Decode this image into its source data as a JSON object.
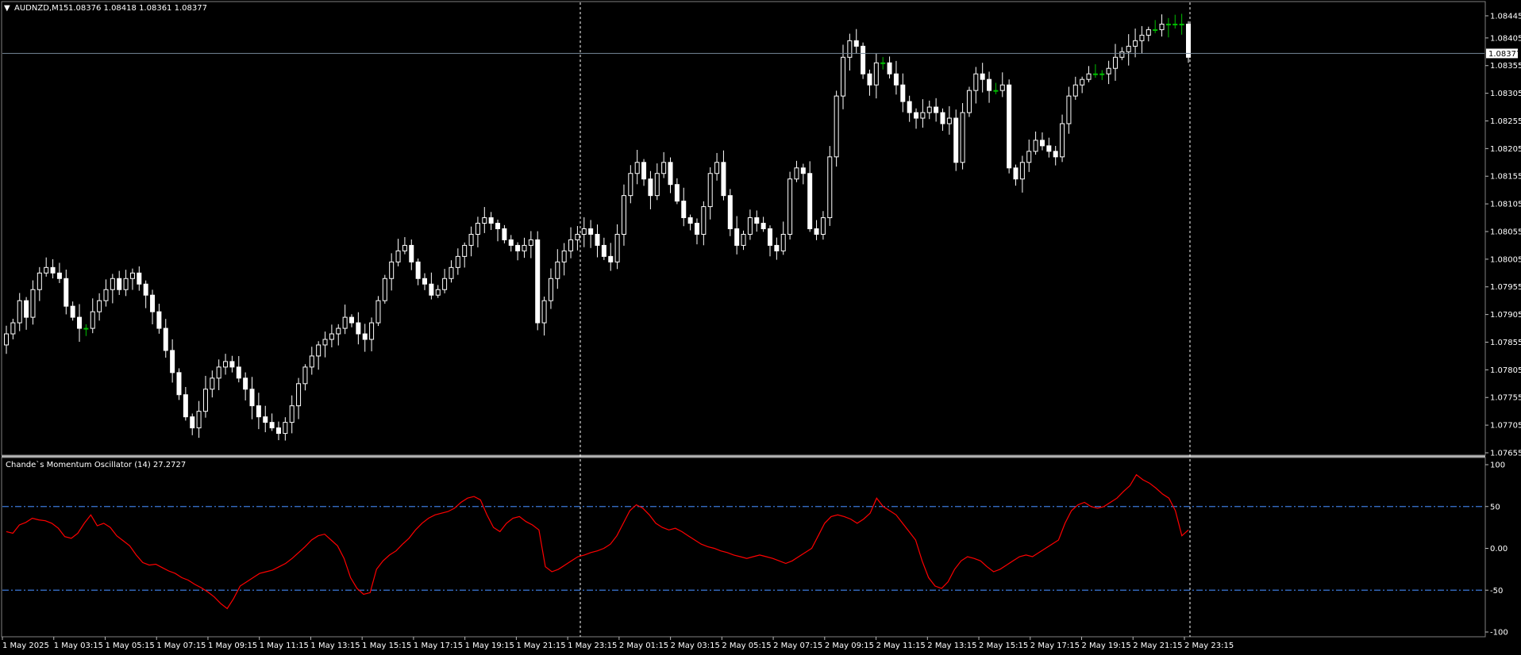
{
  "header": {
    "symbol_label": "AUDNZD,M15",
    "ohlc_values": "1.08376 1.08418 1.08361 1.08377"
  },
  "indicator": {
    "title": "Chande`s Momentum Oscillator (14) 27.2727"
  },
  "colors": {
    "background": "#000000",
    "candle_up": "#ffffff",
    "candle_doji": "#00c000",
    "cmo_line": "#ff0000",
    "level_line": "#3c78d8",
    "price_line": "#778899"
  },
  "chart_data": [
    {
      "type": "candlestick",
      "title": "AUDNZD,M15",
      "ylim": [
        1.07655,
        1.08465
      ],
      "current_price": "1.08377",
      "yticks": [
        "1.08445",
        "1.08405",
        "1.08355",
        "1.08305",
        "1.08255",
        "1.08205",
        "1.08155",
        "1.08105",
        "1.08055",
        "1.08005",
        "1.07955",
        "1.07905",
        "1.07855",
        "1.07805",
        "1.07755",
        "1.07705",
        "1.07655"
      ],
      "xticks": [
        "1 May 2025",
        "1 May 03:15",
        "1 May 05:15",
        "1 May 07:15",
        "1 May 09:15",
        "1 May 11:15",
        "1 May 13:15",
        "1 May 15:15",
        "1 May 17:15",
        "1 May 19:15",
        "1 May 21:15",
        "1 May 23:15",
        "2 May 01:15",
        "2 May 03:15",
        "2 May 05:15",
        "2 May 07:15",
        "2 May 09:15",
        "2 May 11:15",
        "2 May 13:15",
        "2 May 15:15",
        "2 May 17:15",
        "2 May 19:15",
        "2 May 21:15",
        "2 May 23:15"
      ],
      "close_series": [
        1.0787,
        1.0789,
        1.0793,
        1.079,
        1.0795,
        1.0798,
        1.0799,
        1.0798,
        1.0797,
        1.0792,
        1.079,
        1.0788,
        1.0788,
        1.0791,
        1.0793,
        1.0795,
        1.0797,
        1.0795,
        1.0797,
        1.0798,
        1.0796,
        1.0794,
        1.0791,
        1.0788,
        1.0784,
        1.078,
        1.0776,
        1.0772,
        1.077,
        1.0773,
        1.0777,
        1.0779,
        1.0781,
        1.0782,
        1.0781,
        1.0779,
        1.0777,
        1.0774,
        1.0772,
        1.0771,
        1.077,
        1.0769,
        1.0771,
        1.0774,
        1.0778,
        1.0781,
        1.0783,
        1.0785,
        1.0786,
        1.0787,
        1.0788,
        1.079,
        1.0789,
        1.0787,
        1.0786,
        1.0789,
        1.0793,
        1.0797,
        1.08,
        1.0802,
        1.0803,
        1.08,
        1.0797,
        1.0796,
        1.0794,
        1.0795,
        1.0797,
        1.0799,
        1.0801,
        1.0803,
        1.0805,
        1.0807,
        1.0808,
        1.0807,
        1.0806,
        1.0804,
        1.0803,
        1.0802,
        1.0803,
        1.0804,
        1.0789,
        1.0793,
        1.0797,
        1.08,
        1.0802,
        1.0804,
        1.0805,
        1.0806,
        1.0805,
        1.0803,
        1.0801,
        1.08,
        1.0805,
        1.0812,
        1.0816,
        1.0818,
        1.0815,
        1.0812,
        1.0816,
        1.0818,
        1.0814,
        1.0811,
        1.0808,
        1.0807,
        1.0805,
        1.081,
        1.0816,
        1.0818,
        1.0812,
        1.0806,
        1.0803,
        1.0805,
        1.0808,
        1.0807,
        1.0806,
        1.0803,
        1.0802,
        1.0805,
        1.0815,
        1.0817,
        1.0816,
        1.0806,
        1.0805,
        1.0808,
        1.0819,
        1.083,
        1.0837,
        1.084,
        1.0839,
        1.0834,
        1.0832,
        1.0836,
        1.0836,
        1.0834,
        1.0832,
        1.0829,
        1.0827,
        1.0826,
        1.0827,
        1.0828,
        1.0827,
        1.0825,
        1.0826,
        1.0818,
        1.0827,
        1.0831,
        1.0834,
        1.0833,
        1.0831,
        1.0831,
        1.0832,
        1.0817,
        1.0815,
        1.0818,
        1.082,
        1.0822,
        1.0821,
        1.082,
        1.0819,
        1.0825,
        1.083,
        1.0832,
        1.0833,
        1.0834,
        1.0834,
        1.0834,
        1.0835,
        1.0837,
        1.0838,
        1.0839,
        1.084,
        1.0841,
        1.0842,
        1.0842,
        1.0843,
        1.0843,
        1.0843,
        1.0843,
        1.0837
      ]
    },
    {
      "type": "line",
      "title": "Chande`s Momentum Oscillator (14) 27.2727",
      "ylim": [
        -100,
        100
      ],
      "yticks": [
        "100",
        "50",
        "0.00",
        "-50",
        "-100"
      ],
      "levels": [
        50,
        -50
      ],
      "values": [
        20,
        18,
        28,
        31,
        36,
        34,
        33,
        30,
        24,
        14,
        12,
        18,
        30,
        40,
        27,
        30,
        25,
        15,
        9,
        3,
        -8,
        -17,
        -20,
        -19,
        -23,
        -27,
        -30,
        -35,
        -38,
        -43,
        -47,
        -52,
        -58,
        -66,
        -72,
        -60,
        -45,
        -40,
        -35,
        -30,
        -28,
        -26,
        -22,
        -18,
        -12,
        -5,
        2,
        10,
        15,
        17,
        10,
        3,
        -12,
        -35,
        -48,
        -55,
        -53,
        -25,
        -15,
        -8,
        -3,
        5,
        12,
        22,
        30,
        36,
        40,
        42,
        44,
        48,
        55,
        60,
        62,
        58,
        40,
        25,
        20,
        30,
        36,
        38,
        32,
        28,
        22,
        -22,
        -28,
        -25,
        -20,
        -15,
        -10,
        -8,
        -5,
        -3,
        0,
        5,
        15,
        30,
        45,
        52,
        48,
        40,
        30,
        25,
        22,
        24,
        20,
        15,
        10,
        5,
        2,
        0,
        -3,
        -5,
        -8,
        -10,
        -12,
        -10,
        -8,
        -10,
        -12,
        -15,
        -18,
        -15,
        -10,
        -5,
        0,
        15,
        30,
        38,
        40,
        38,
        35,
        30,
        35,
        42,
        60,
        50,
        45,
        40,
        30,
        20,
        10,
        -15,
        -35,
        -45,
        -48,
        -40,
        -25,
        -15,
        -10,
        -12,
        -15,
        -22,
        -28,
        -25,
        -20,
        -15,
        -10,
        -8,
        -10,
        -5,
        0,
        5,
        10,
        30,
        45,
        52,
        55,
        50,
        48,
        50,
        55,
        60,
        68,
        75,
        88,
        82,
        78,
        72,
        65,
        60,
        45,
        15,
        22
      ]
    }
  ]
}
